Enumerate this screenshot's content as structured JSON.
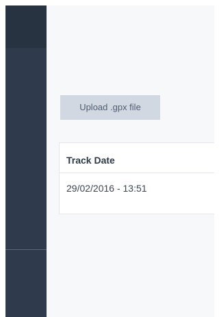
{
  "upload": {
    "label": "Upload .gpx file"
  },
  "tracks_table": {
    "columns": [
      "Track Date"
    ],
    "rows": [
      [
        "29/02/2016 - 13:51"
      ]
    ]
  },
  "colors": {
    "sidebar": "#2f3b4c",
    "sidebar_top": "#283342",
    "main_background": "#f7f8fa",
    "button_background": "#d2d8e1",
    "button_text": "#4f5d70"
  }
}
